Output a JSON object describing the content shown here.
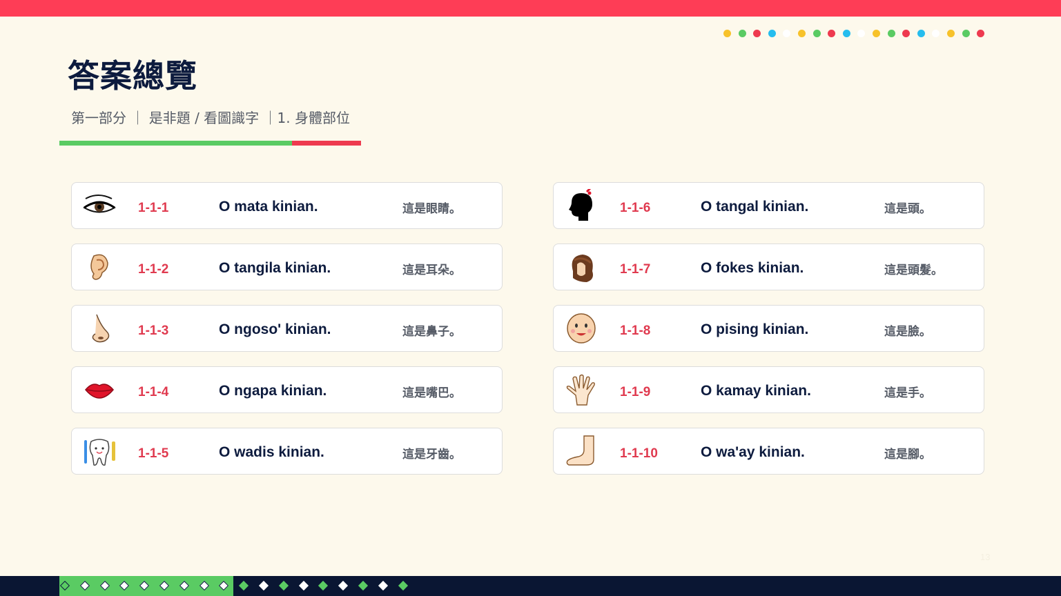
{
  "colors": {
    "accent_red": "#fe3d56",
    "accent_green": "#5acb63",
    "navy": "#0d1b3e",
    "background": "#fdf9ec",
    "dot_palette": [
      "#f7c22a",
      "#5acb63",
      "#ee3a4f",
      "#26bdee",
      "#ffffff"
    ]
  },
  "header": {
    "title": "答案總覽",
    "subtitle": "第一部分 ｜ 是非題 / 看圖識字 ｜1. 身體部位"
  },
  "items": [
    {
      "code": "1-1-1",
      "sentence": "O mata kinian.",
      "meaning": "這是眼睛。",
      "icon": "eye-icon"
    },
    {
      "code": "1-1-2",
      "sentence": "O tangila kinian.",
      "meaning": "這是耳朵。",
      "icon": "ear-icon"
    },
    {
      "code": "1-1-3",
      "sentence": "O ngoso' kinian.",
      "meaning": "這是鼻子。",
      "icon": "nose-icon"
    },
    {
      "code": "1-1-4",
      "sentence": "O ngapa kinian.",
      "meaning": "這是嘴巴。",
      "icon": "lips-icon"
    },
    {
      "code": "1-1-5",
      "sentence": "O wadis kinian.",
      "meaning": "這是牙齒。",
      "icon": "tooth-icon"
    },
    {
      "code": "1-1-6",
      "sentence": "O tangal kinian.",
      "meaning": "這是頭。",
      "icon": "head-icon"
    },
    {
      "code": "1-1-7",
      "sentence": "O fokes kinian.",
      "meaning": "這是頭髮。",
      "icon": "hair-icon"
    },
    {
      "code": "1-1-8",
      "sentence": "O pising kinian.",
      "meaning": "這是臉。",
      "icon": "face-icon"
    },
    {
      "code": "1-1-9",
      "sentence": "O kamay kinian.",
      "meaning": "這是手。",
      "icon": "hand-icon"
    },
    {
      "code": "1-1-10",
      "sentence": "O wa'ay kinian.",
      "meaning": "這是腳。",
      "icon": "foot-icon"
    }
  ],
  "footer": {
    "page_number": "13"
  }
}
